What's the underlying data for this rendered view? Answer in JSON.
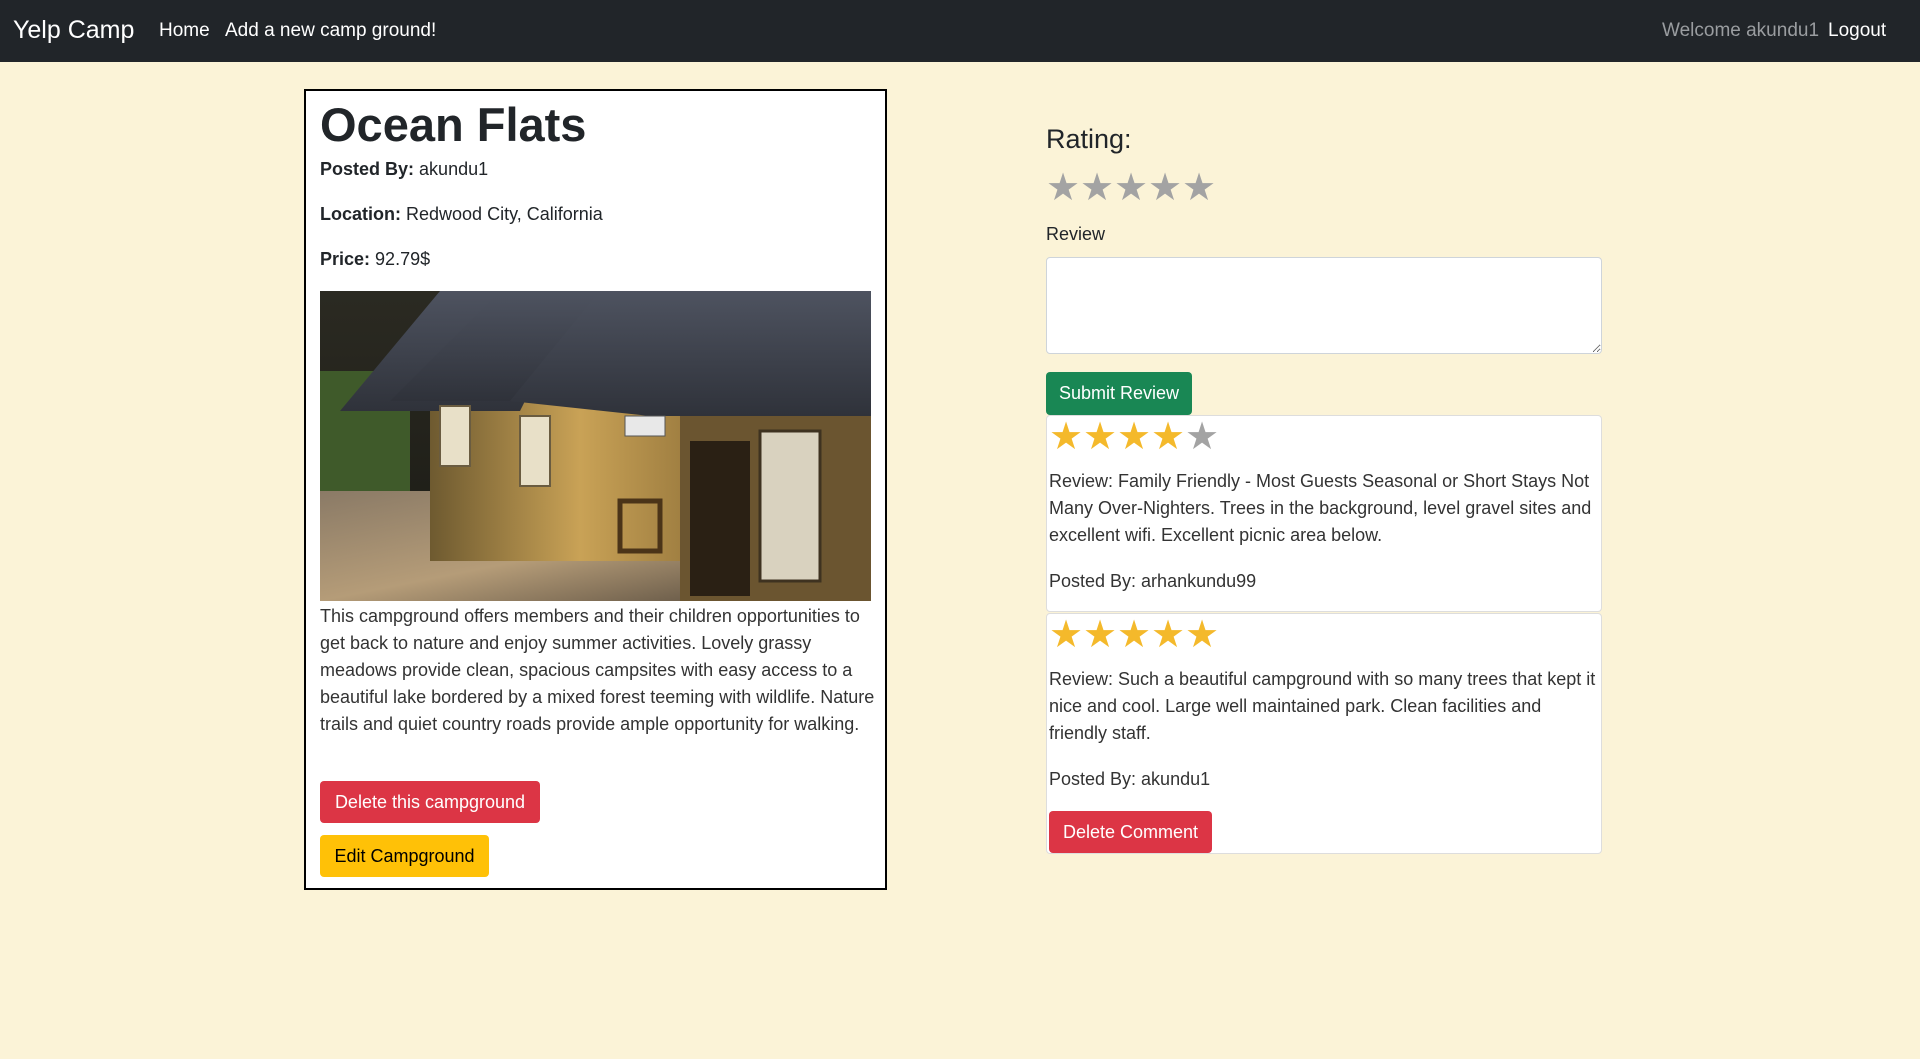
{
  "navbar": {
    "brand": "Yelp Camp",
    "home": "Home",
    "add_new": "Add a new camp ground!",
    "welcome": "Welcome akundu1",
    "logout": "Logout"
  },
  "campground": {
    "title": "Ocean Flats",
    "posted_by_label": "Posted By:",
    "posted_by": "akundu1",
    "location_label": "Location:",
    "location": "Redwood City, California",
    "price_label": "Price:",
    "price": "92.79$",
    "description": "This campground offers members and their children opportunities to get back to nature and enjoy summer activities. Lovely grassy meadows provide clean, spacious campsites with easy access to a beautiful lake bordered by a mixed forest teeming with wildlife. Nature trails and quiet country roads provide ample opportunity for walking.",
    "delete_button": "Delete this campground",
    "edit_button": "Edit Campground"
  },
  "review_form": {
    "rating_label": "Rating:",
    "rating_value": 0,
    "rating_max": 5,
    "review_label": "Review",
    "review_value": "",
    "submit_button": "Submit Review"
  },
  "reviews": [
    {
      "rating": 4,
      "text": "Review: Family Friendly - Most Guests Seasonal or Short Stays Not Many Over-Nighters. Trees in the background, level gravel sites and excellent wifi. Excellent picnic area below.",
      "author": "Posted By: arhankundu99"
    },
    {
      "rating": 5,
      "text": "Review: Such a beautiful campground with so many trees that kept it nice and cool. Large well maintained park. Clean facilities and friendly staff.",
      "author": "Posted By: akundu1",
      "delete_button": "Delete Comment"
    }
  ],
  "colors": {
    "page_bg": "#fbf3d7",
    "navbar_bg": "#212529",
    "danger": "#dc3545",
    "warning": "#ffc107",
    "success": "#198754",
    "star_filled": "#f4b92b",
    "star_empty": "#a3a3a3"
  }
}
